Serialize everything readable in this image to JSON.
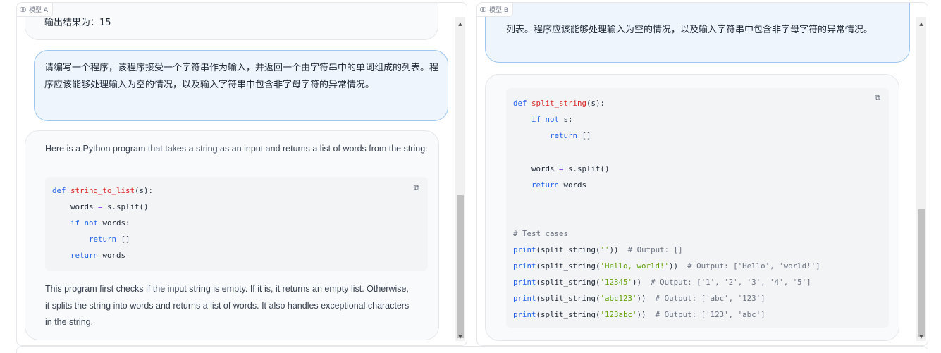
{
  "panel_a": {
    "tag": "模型 A",
    "prev_output": "输出结果为：15",
    "user_prompt": "请编写一个程序，该程序接受一个字符串作为输入，并返回一个由字符串中的单词组成的列表。程序应该能够处理输入为空的情况，以及输入字符串中包含非字母字符的异常情况。",
    "answer_intro": "Here is a Python program that takes a string as an input and returns a list of words from the string:",
    "code_lines": [
      "def string_to_list(s):",
      "    words = s.split()",
      "    if not words:",
      "        return []",
      "    return words"
    ],
    "answer_outro": "This program first checks if the input string is empty. If it is, it returns an empty list. Otherwise, it splits the string into words and returns a list of words. It also handles exceptional characters in the string."
  },
  "panel_b": {
    "tag": "模型 B",
    "user_prompt_tail": "列表。程序应该能够处理输入为空的情况，以及输入字符串中包含非字母字符的异常情况。",
    "code_lines": [
      "def split_string(s):",
      "    if not s:",
      "        return []",
      "",
      "    words = s.split()",
      "    return words",
      "",
      "",
      "# Test cases",
      "print(split_string(''))  # Output: []",
      "print(split_string('Hello, world!'))  # Output: ['Hello', 'world!']",
      "print(split_string('12345'))  # Output: ['1', '2', '3', '4', '5']",
      "print(split_string('abc123'))  # Output: ['abc', '123']",
      "print(split_string('123abc'))  # Output: ['123', 'abc']"
    ]
  },
  "icons": {
    "copy": "copy-icon",
    "model": "model-icon",
    "scroll_up": "scroll-up-arrow",
    "scroll_down": "scroll-down-arrow"
  },
  "colors": {
    "keyword": "#2563eb",
    "function": "#dc2626",
    "string": "#65a30d",
    "comment": "#6b7280",
    "user_bubble_bg": "#eef5fd",
    "user_bubble_border": "#9ec6ef"
  }
}
